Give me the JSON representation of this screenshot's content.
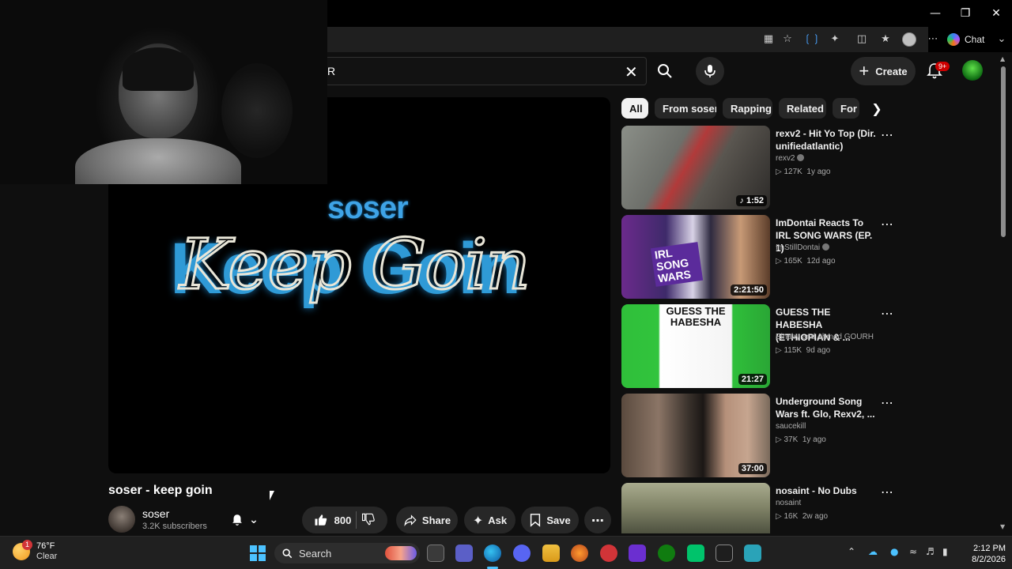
{
  "browser": {
    "chat_label": "Chat",
    "min_icon": "minimize-icon",
    "max_icon": "maximize-icon",
    "close_icon": "close-icon"
  },
  "header": {
    "search_query": "R",
    "create_label": "Create",
    "notifications_badge": "9+"
  },
  "video": {
    "artist_art_text": "soser",
    "title_art_text": "Keep Goin",
    "title": "soser - keep goin",
    "channel_name": "soser",
    "subscribers": "3.2K subscribers",
    "likes": "800",
    "share_label": "Share",
    "ask_label": "Ask",
    "save_label": "Save"
  },
  "chips": [
    "All",
    "From soser",
    "Rapping",
    "Related",
    "For y"
  ],
  "recommendations": [
    {
      "title": "rexv2 - Hit Yo Top (Dir. unifiedatlantic)",
      "channel": "rexv2",
      "verified": true,
      "views": "127K",
      "age": "1y ago",
      "duration": "1:52",
      "music": true
    },
    {
      "title": "ImDontai Reacts To IRL SONG WARS (EP. 1)",
      "channel": "ImStillDontai",
      "verified": true,
      "views": "165K",
      "age": "12d ago",
      "duration": "2:21:50",
      "thumb_text": "IRL SONG WARS"
    },
    {
      "title": "GUESS THE HABESHA (ETHIOPIAN & ...",
      "channel": "Elnaby and Ahmed GOURH",
      "verified": false,
      "views": "115K",
      "age": "9d ago",
      "duration": "21:27",
      "thumb_text": "GUESS THE HABESHA"
    },
    {
      "title": "Underground Song Wars ft. Glo, Rexv2, ...",
      "channel": "saucekill",
      "verified": false,
      "views": "37K",
      "age": "1y ago",
      "duration": "37:00"
    },
    {
      "title": "nosaint - No Dubs",
      "channel": "nosaint",
      "verified": false,
      "views": "16K",
      "age": "2w ago",
      "duration": ""
    }
  ],
  "taskbar": {
    "temperature": "76°F",
    "condition": "Clear",
    "weather_badge": "1",
    "search_label": "Search",
    "time": "2:12 PM",
    "date": "8/2/2026"
  },
  "colors": {
    "bg": "#0f0f0f",
    "chip": "#272727",
    "chip_active": "#f1f1f1",
    "accent_blue": "#3ea3e6",
    "badge_red": "#cc0000"
  }
}
